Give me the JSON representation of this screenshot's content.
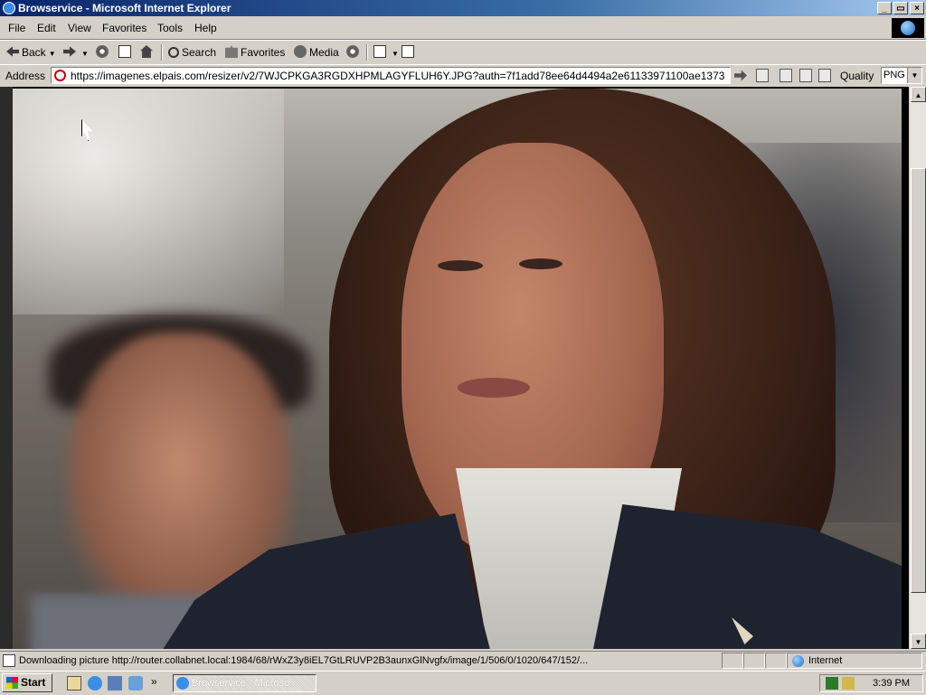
{
  "window": {
    "title": "Browservice - Microsoft Internet Explorer",
    "controls": [
      "_",
      "▭",
      "×"
    ]
  },
  "menu": [
    "File",
    "Edit",
    "View",
    "Favorites",
    "Tools",
    "Help"
  ],
  "toolbar": {
    "back_label": "Back",
    "search_label": "Search",
    "favorites_label": "Favorites",
    "media_label": "Media"
  },
  "address": {
    "label": "Address",
    "url": "https://imagenes.elpais.com/resizer/v2/7WJCPKGA3RGDXHPMLAGYFLUH6Y.JPG?auth=7f1add78ee64d4494a2e61133971100ae1373"
  },
  "quality": {
    "label": "Quality",
    "value": "PNG"
  },
  "status": {
    "text": "Downloading picture http://router.collabnet.local:1984/68/rWxZ3y8iEL7GtLRUVP2B3aunxGlNvgfx/image/1/506/0/1020/647/152/...",
    "zone": "Internet"
  },
  "taskbar": {
    "start_label": "Start",
    "task_label": "Browservice - Microso...",
    "clock": "3:39 PM"
  }
}
